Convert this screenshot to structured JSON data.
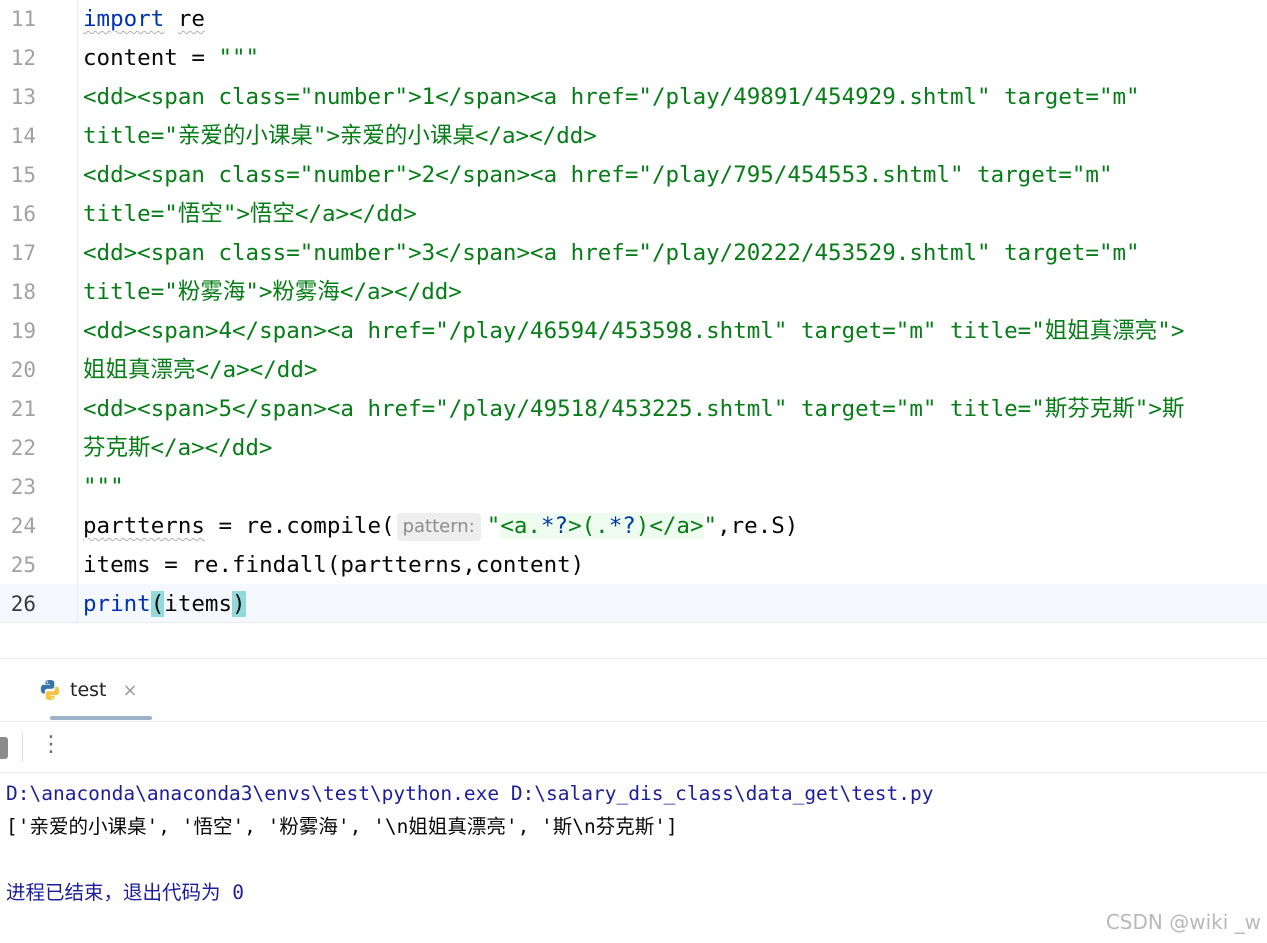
{
  "editor": {
    "lines": [
      {
        "num": "11",
        "segments": [
          {
            "t": "import",
            "c": "kw squiggle"
          },
          {
            "t": " "
          },
          {
            "t": "re",
            "c": "squiggle"
          }
        ]
      },
      {
        "num": "12",
        "segments": [
          {
            "t": "content = "
          },
          {
            "t": "\"\"\"",
            "c": "str"
          }
        ]
      },
      {
        "num": "13",
        "segments": [
          {
            "t": "<dd><span class=\"number\">1</span><a href=\"/play/49891/454929.shtml\" target=\"m\"",
            "c": "str"
          }
        ]
      },
      {
        "num": "14",
        "segments": [
          {
            "t": "title=\"亲爱的小课桌\">亲爱的小课桌</a></dd>",
            "c": "str"
          }
        ]
      },
      {
        "num": "15",
        "segments": [
          {
            "t": "<dd><span class=\"number\">2</span><a href=\"/play/795/454553.shtml\" target=\"m\"",
            "c": "str"
          }
        ]
      },
      {
        "num": "16",
        "segments": [
          {
            "t": "title=\"悟空\">悟空</a></dd>",
            "c": "str"
          }
        ]
      },
      {
        "num": "17",
        "segments": [
          {
            "t": "<dd><span class=\"number\">3</span><a href=\"/play/20222/453529.shtml\" target=\"m\"",
            "c": "str"
          }
        ]
      },
      {
        "num": "18",
        "segments": [
          {
            "t": "title=\"粉雾海\">粉雾海</a></dd>",
            "c": "str"
          }
        ]
      },
      {
        "num": "19",
        "segments": [
          {
            "t": "<dd><span>4</span><a href=\"/play/46594/453598.shtml\" target=\"m\" title=\"姐姐真漂亮\">",
            "c": "str"
          }
        ]
      },
      {
        "num": "20",
        "segments": [
          {
            "t": "姐姐真漂亮</a></dd>",
            "c": "str"
          }
        ]
      },
      {
        "num": "21",
        "segments": [
          {
            "t": "<dd><span>5</span><a href=\"/play/49518/453225.shtml\" target=\"m\" title=\"斯芬克斯\">斯",
            "c": "str"
          }
        ]
      },
      {
        "num": "22",
        "segments": [
          {
            "t": "芬克斯</a></dd>",
            "c": "str"
          }
        ]
      },
      {
        "num": "23",
        "segments": [
          {
            "t": "\"\"\"",
            "c": "str"
          }
        ]
      },
      {
        "num": "24",
        "segments": [
          {
            "t": "partterns",
            "c": "squiggle"
          },
          {
            "t": " = re.compile("
          },
          {
            "t": "pattern:",
            "c": "hint"
          },
          {
            "t": "\"",
            "c": "str"
          },
          {
            "t": "<a.",
            "c": "str regex-bg"
          },
          {
            "t": "*?",
            "c": "regex-op regex-bg"
          },
          {
            "t": ">(.",
            "c": "str regex-bg"
          },
          {
            "t": "*?",
            "c": "regex-op regex-bg"
          },
          {
            "t": ")</a>",
            "c": "str regex-bg"
          },
          {
            "t": "\"",
            "c": "str"
          },
          {
            "t": ",re.S)"
          }
        ]
      },
      {
        "num": "25",
        "segments": [
          {
            "t": "items = re.findall(partterns,content)"
          }
        ]
      },
      {
        "num": "26",
        "current": true,
        "segments": [
          {
            "t": "print",
            "c": "kw"
          },
          {
            "t": "(",
            "c": "brace-hl"
          },
          {
            "t": "items"
          },
          {
            "t": ")",
            "c": "brace-hl"
          }
        ]
      }
    ]
  },
  "run_panel": {
    "tab_label": "test",
    "tab_icon": "python-icon",
    "close_glyph": "×",
    "more_glyph": "⋮",
    "console": {
      "command": "D:\\anaconda\\anaconda3\\envs\\test\\python.exe D:\\salary_dis_class\\data_get\\test.py",
      "output": "['亲爱的小课桌', '悟空', '粉雾海', '\\n姐姐真漂亮', '斯\\n芬克斯']",
      "exit_message": "进程已结束，退出代码为 0"
    }
  },
  "watermark": "CSDN @wiki _w",
  "colors": {
    "keyword": "#0033b3",
    "string": "#067d17",
    "regex_bg": "#edfcee",
    "brace_highlight": "#93d9d9",
    "current_line": "#f5f8fe",
    "console_command": "#1d1d9a"
  }
}
